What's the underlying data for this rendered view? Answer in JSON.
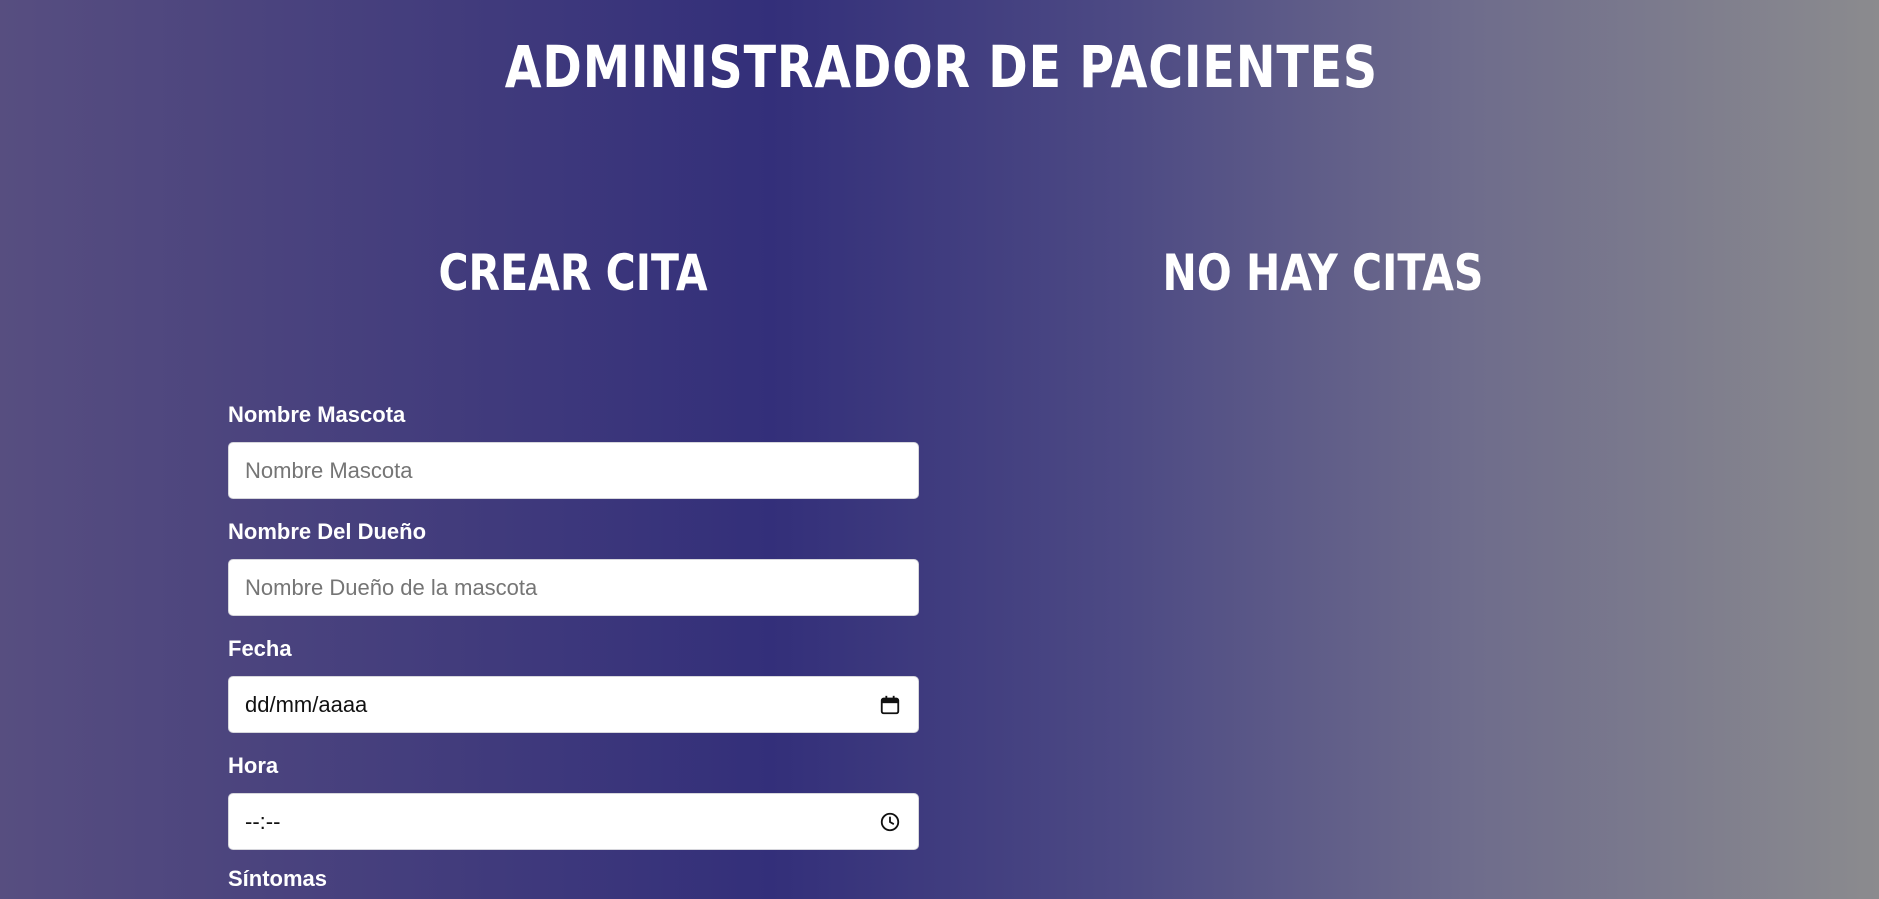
{
  "header": {
    "title": "ADMINISTRADOR DE PACIENTES"
  },
  "form_section": {
    "title": "CREAR CITA",
    "fields": [
      {
        "label": "Nombre Mascota",
        "placeholder": "Nombre Mascota",
        "value": ""
      },
      {
        "label": "Nombre Del Dueño",
        "placeholder": "Nombre Dueño de la mascota",
        "value": ""
      },
      {
        "label": "Fecha",
        "display_value": "dd/mm/aaaa",
        "icon": "calendar-icon"
      },
      {
        "label": "Hora",
        "display_value": "--:--",
        "icon": "clock-icon"
      },
      {
        "label": "Síntomas"
      }
    ]
  },
  "list_section": {
    "title": "NO HAY CITAS"
  }
}
